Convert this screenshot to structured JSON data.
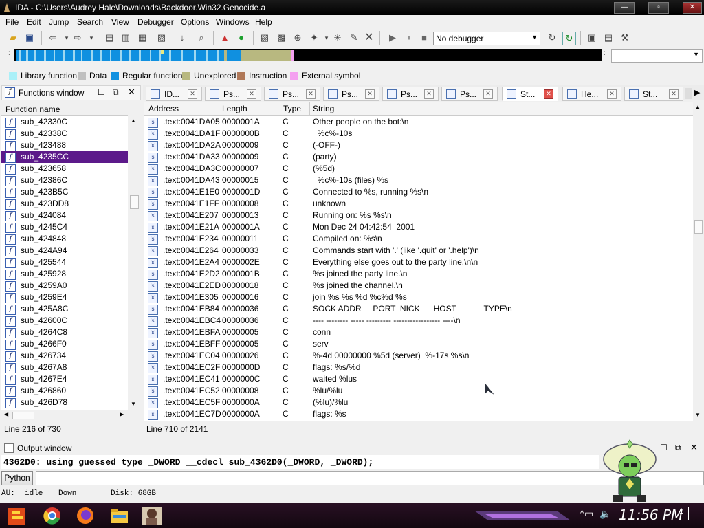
{
  "window": {
    "title": "IDA - C:\\Users\\Audrey Hale\\Downloads\\Backdoor.Win32.Genocide.a"
  },
  "menu": [
    "File",
    "Edit",
    "Jump",
    "Search",
    "View",
    "Debugger",
    "Options",
    "Windows",
    "Help"
  ],
  "toolbar": {
    "debugger_select": "No debugger"
  },
  "legend": [
    {
      "label": "Library function",
      "color": "#aaf0f8"
    },
    {
      "label": "Data",
      "color": "#c0c0c0"
    },
    {
      "label": "Regular function",
      "color": "#1090e0"
    },
    {
      "label": "Unexplored",
      "color": "#b8b880"
    },
    {
      "label": "Instruction",
      "color": "#b07858"
    },
    {
      "label": "External symbol",
      "color": "#f4a0f0"
    }
  ],
  "functions": {
    "title": "Functions window",
    "column": "Function name",
    "items": [
      "sub_42330C",
      "sub_42338C",
      "sub_423488",
      "sub_4235CC",
      "sub_423658",
      "sub_42386C",
      "sub_423B5C",
      "sub_423DD8",
      "sub_424084",
      "sub_4245C4",
      "sub_424848",
      "sub_424A94",
      "sub_425544",
      "sub_425928",
      "sub_4259A0",
      "sub_4259E4",
      "sub_425A8C",
      "sub_42600C",
      "sub_4264C8",
      "sub_4266F0",
      "sub_426734",
      "sub_4267A8",
      "sub_4267E4",
      "sub_426860",
      "sub_426D78"
    ],
    "selected_index": 3,
    "status": "Line 216 of 730"
  },
  "tabs": [
    {
      "label": "ID..."
    },
    {
      "label": "Ps..."
    },
    {
      "label": "Ps..."
    },
    {
      "label": "Ps..."
    },
    {
      "label": "Ps..."
    },
    {
      "label": "Ps..."
    },
    {
      "label": "St...",
      "active": true
    },
    {
      "label": "He..."
    },
    {
      "label": "St..."
    }
  ],
  "strings": {
    "columns": [
      "Address",
      "Length",
      "Type",
      "String"
    ],
    "rows": [
      [
        ".text:0041DA05",
        "0000001A",
        "C",
        "Other people on the bot:\\n"
      ],
      [
        ".text:0041DA1F",
        "0000000B",
        "C",
        "  %c%-10s"
      ],
      [
        ".text:0041DA2A",
        "00000009",
        "C",
        "(-OFF-)"
      ],
      [
        ".text:0041DA33",
        "00000009",
        "C",
        "(party)"
      ],
      [
        ".text:0041DA3C",
        "00000007",
        "C",
        "(%5d)"
      ],
      [
        ".text:0041DA43",
        "00000015",
        "C",
        "  %c%-10s (files) %s"
      ],
      [
        ".text:0041E1E0",
        "0000001D",
        "C",
        "Connected to %s, running %s\\n"
      ],
      [
        ".text:0041E1FF",
        "00000008",
        "C",
        "unknown"
      ],
      [
        ".text:0041E207",
        "00000013",
        "C",
        "Running on: %s %s\\n"
      ],
      [
        ".text:0041E21A",
        "0000001A",
        "C",
        "Mon Dec 24 04:42:54  2001"
      ],
      [
        ".text:0041E234",
        "00000011",
        "C",
        "Compiled on: %s\\n"
      ],
      [
        ".text:0041E264",
        "00000033",
        "C",
        "Commands start with '.' (like '.quit' or '.help')\\n"
      ],
      [
        ".text:0041E2A4",
        "0000002E",
        "C",
        "Everything else goes out to the party line.\\n\\n"
      ],
      [
        ".text:0041E2D2",
        "0000001B",
        "C",
        "%s joined the party line.\\n"
      ],
      [
        ".text:0041E2ED",
        "00000018",
        "C",
        "%s joined the channel.\\n"
      ],
      [
        ".text:0041E305",
        "00000016",
        "C",
        "join %s %s %d %c%d %s"
      ],
      [
        ".text:0041EB84",
        "00000036",
        "C",
        "SOCK ADDR     PORT  NICK      HOST            TYPE\\n"
      ],
      [
        ".text:0041EBC4",
        "00000036",
        "C",
        "---- -------- ----- --------- ----------------- ----\\n"
      ],
      [
        ".text:0041EBFA",
        "00000005",
        "C",
        "conn"
      ],
      [
        ".text:0041EBFF",
        "00000005",
        "C",
        "serv"
      ],
      [
        ".text:0041EC04",
        "00000026",
        "C",
        "%-4d 00000000 %5d (server)  %-17s %s\\n"
      ],
      [
        ".text:0041EC2F",
        "0000000D",
        "C",
        "flags: %s/%d"
      ],
      [
        ".text:0041EC41",
        "0000000C",
        "C",
        "waited %lus"
      ],
      [
        ".text:0041EC52",
        "00000008",
        "C",
        "%lu/%lu"
      ],
      [
        ".text:0041EC5F",
        "0000000A",
        "C",
        "(%lu)/%lu"
      ],
      [
        ".text:0041EC7D",
        "0000000A",
        "C",
        "flags: %s"
      ]
    ],
    "status": "Line 710 of 2141"
  },
  "output": {
    "title": "Output window",
    "text": "4362D0: using guessed type _DWORD __cdecl sub_4362D0(_DWORD, _DWORD);",
    "python_button": "Python"
  },
  "statusbar": {
    "au": "AU:",
    "state": "idle",
    "direction": "Down",
    "disk": "Disk: 68GB"
  },
  "taskbar": {
    "time": "11:56 PM",
    "notifications": "1"
  }
}
